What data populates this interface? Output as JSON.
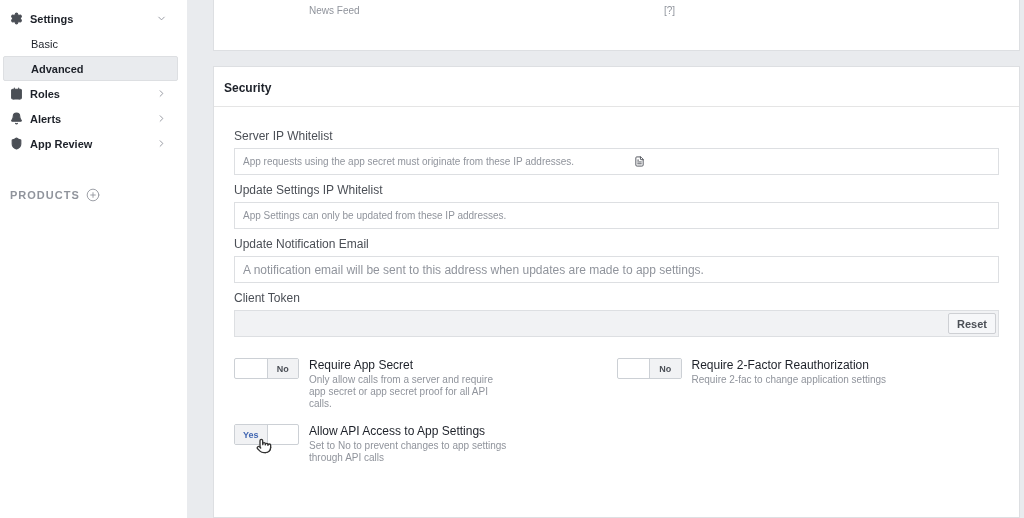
{
  "sidebar": {
    "items": [
      {
        "label": "Settings",
        "expanded": true,
        "selected": false,
        "children": [
          {
            "label": "Basic",
            "selected": false
          },
          {
            "label": "Advanced",
            "selected": true
          }
        ]
      },
      {
        "label": "Roles",
        "expanded": false,
        "selected": false
      },
      {
        "label": "Alerts",
        "expanded": false,
        "selected": false
      },
      {
        "label": "App Review",
        "expanded": false,
        "selected": false
      }
    ],
    "products_label": "PRODUCTS"
  },
  "top_card": {
    "left_text": "News Feed",
    "right_text": "[?]"
  },
  "security": {
    "title": "Security",
    "fields": [
      {
        "label": "Server IP Whitelist",
        "placeholder": "App requests using the app secret must originate from these IP addresses.",
        "kind": "note"
      },
      {
        "label": "Update Settings IP Whitelist",
        "placeholder": "App Settings can only be updated from these IP addresses.",
        "kind": "text"
      },
      {
        "label": "Update Notification Email",
        "placeholder": "A notification email will be sent to this address when updates are made to app settings.",
        "kind": "large"
      },
      {
        "label": "Client Token",
        "kind": "token",
        "button": "Reset"
      }
    ],
    "toggles": [
      {
        "title": "Require App Secret",
        "description": "Only allow calls from a server and require app secret or app secret proof for all API calls.",
        "on": false,
        "state_label": "No"
      },
      {
        "title": "Require 2-Factor Reauthorization",
        "description": "Require 2-fac to change application settings",
        "on": false,
        "state_label": "No"
      },
      {
        "title": "Allow API Access to App Settings",
        "description": "Set to No to prevent changes to app settings through API calls",
        "on": true,
        "state_label": "Yes"
      }
    ]
  }
}
